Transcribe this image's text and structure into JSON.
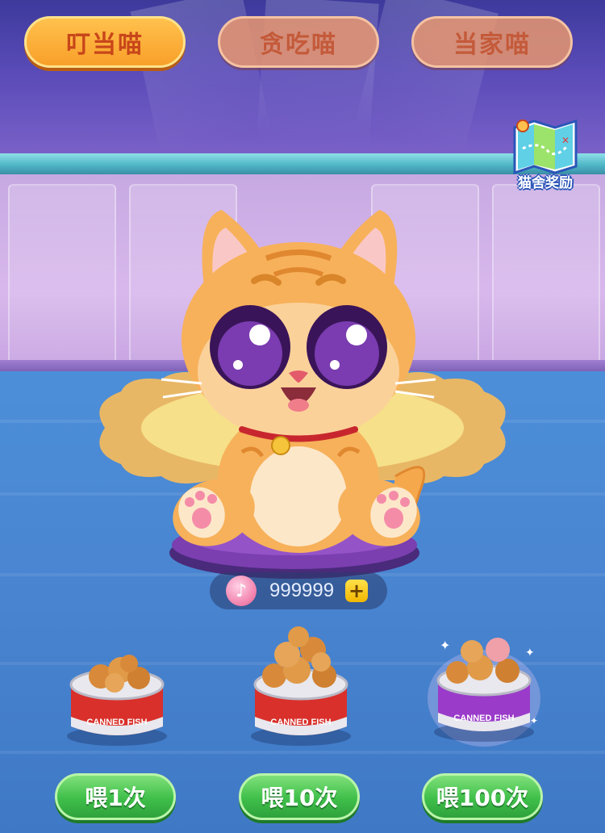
{
  "tabs": [
    {
      "label": "叮当喵",
      "active": true
    },
    {
      "label": "贪吃喵",
      "active": false
    },
    {
      "label": "当家喵",
      "active": false
    }
  ],
  "reward": {
    "label": "猫舍奖励",
    "icon": "map-icon"
  },
  "currency": {
    "icon": "music-note-coin-icon",
    "amount": "999999",
    "add_icon": "plus-icon"
  },
  "foods": [
    {
      "can_label": "CANNED FISH",
      "color": "#d9302b",
      "button": "喂1次"
    },
    {
      "can_label": "CANNED FISH",
      "color": "#d9302b",
      "button": "喂10次"
    },
    {
      "can_label": "CANNED FISH",
      "color": "#9a3bc9",
      "button": "喂100次"
    }
  ],
  "colors": {
    "tab_active": "#f8a02a",
    "tab_idle": "#e8966e",
    "feed_button": "#3fbf4a",
    "floor": "#4a86d2",
    "wall": "#d8b8ec"
  }
}
